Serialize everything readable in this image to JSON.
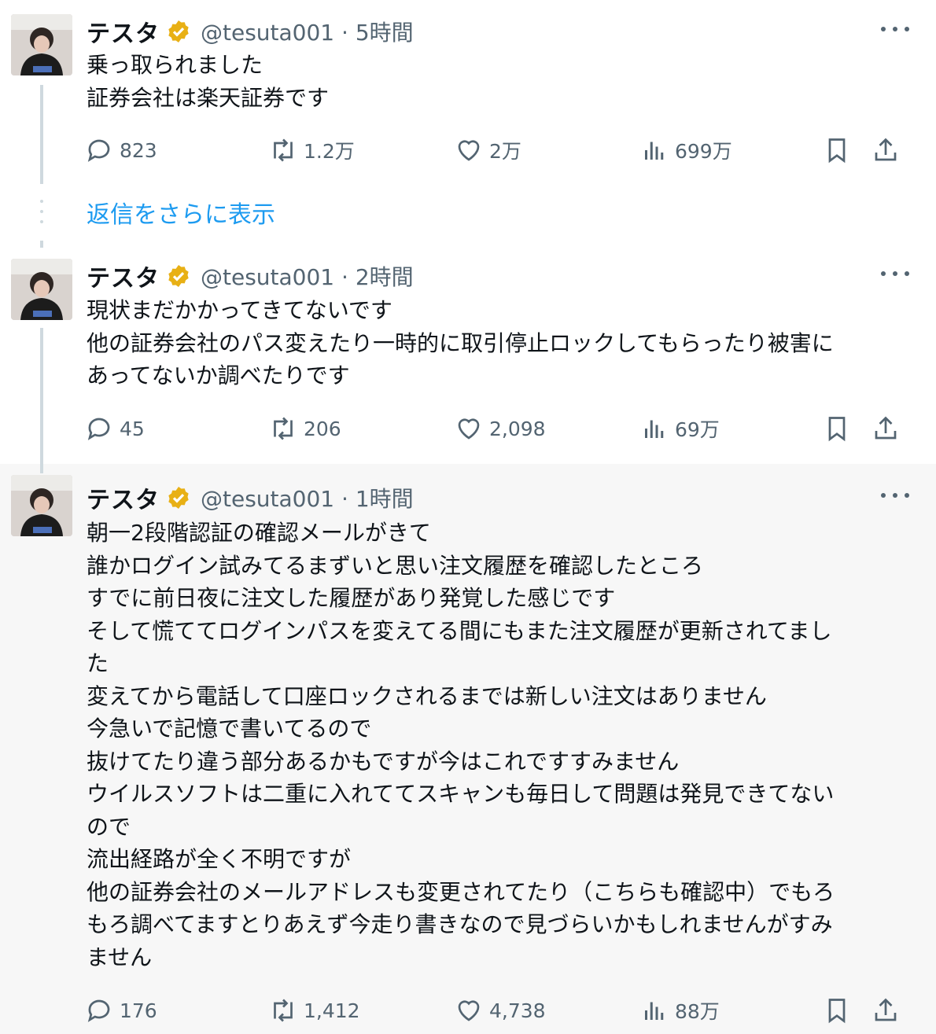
{
  "colors": {
    "accent": "#1d9bf0",
    "verified": "#e8b015",
    "muted": "#536471",
    "text": "#0f1419"
  },
  "tweets": [
    {
      "name": "テスタ",
      "handle": "@tesuta001 · 5時間",
      "lines": [
        "乗っ取られました",
        "証券会社は楽天証券です"
      ],
      "replies": "823",
      "retweets": "1.2万",
      "likes": "2万",
      "views": "699万"
    },
    {
      "name": "テスタ",
      "handle": "@tesuta001 · 2時間",
      "lines": [
        "現状まだかかってきてないです",
        "他の証券会社のパス変えたり一時的に取引停止ロックしてもらったり被害に",
        "あってないか調べたりです"
      ],
      "replies": "45",
      "retweets": "206",
      "likes": "2,098",
      "views": "69万"
    },
    {
      "name": "テスタ",
      "handle": "@tesuta001 · 1時間",
      "lines": [
        "朝一2段階認証の確認メールがきて",
        "誰かログイン試みてるまずいと思い注文履歴を確認したところ",
        "すでに前日夜に注文した履歴があり発覚した感じです",
        "そして慌ててログインパスを変えてる間にもまた注文履歴が更新されてまし",
        "た",
        "変えてから電話して口座ロックされるまでは新しい注文はありません",
        "今急いで記憶で書いてるので",
        "抜けてたり違う部分あるかもですが今はこれですすみません",
        "ウイルスソフトは二重に入れててスキャンも毎日して問題は発見できてない",
        "ので",
        "流出経路が全く不明ですが",
        "他の証券会社のメールアドレスも変更されてたり（こちらも確認中）でもろ",
        "もろ調べてますとりあえず今走り書きなので見づらいかもしれませんがすみ",
        "ません"
      ],
      "replies": "176",
      "retweets": "1,412",
      "likes": "4,738",
      "views": "88万"
    }
  ],
  "show_more_replies": "返信をさらに表示",
  "icons": [
    "verified-badge-icon",
    "more-icon",
    "reply-icon",
    "retweet-icon",
    "like-icon",
    "views-icon",
    "bookmark-icon",
    "share-icon"
  ]
}
